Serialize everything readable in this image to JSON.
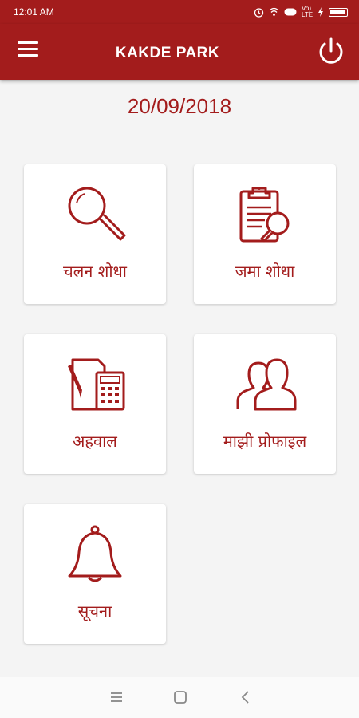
{
  "status": {
    "time": "12:01 AM",
    "net": "Vo) LTE",
    "icons": [
      "alarm-icon",
      "wifi-icon",
      "volte-icon",
      "signal-icon",
      "charging-icon",
      "battery-icon"
    ]
  },
  "appbar": {
    "title": "KAKDE PARK",
    "menu_icon": "hamburger-icon",
    "power_icon": "power-icon"
  },
  "date": "20/09/2018",
  "cards": [
    {
      "label": "चलन शोधा",
      "icon": "search-icon"
    },
    {
      "label": "जमा शोधा",
      "icon": "clipboard-search-icon"
    },
    {
      "label": "अहवाल",
      "icon": "report-calculator-icon"
    },
    {
      "label": "माझी प्रोफाइल",
      "icon": "users-icon"
    },
    {
      "label": "सूचना",
      "icon": "bell-icon"
    }
  ],
  "colors": {
    "primary": "#a31c1c",
    "background": "#f4f4f4",
    "card": "#ffffff"
  },
  "navbar": {
    "icons": [
      "recent-apps-icon",
      "home-icon",
      "back-icon"
    ]
  }
}
